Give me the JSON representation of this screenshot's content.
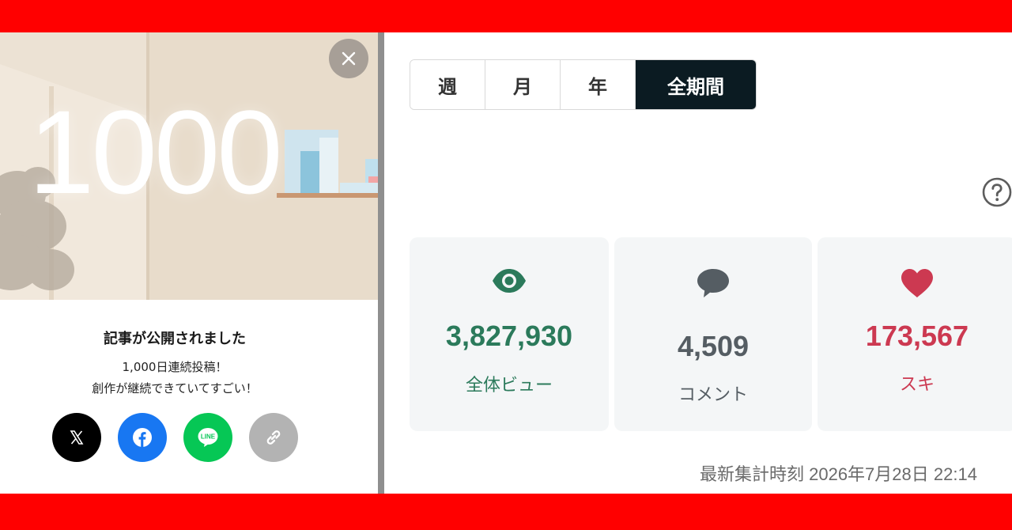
{
  "modal": {
    "hero_number": "1000",
    "title": "記事が公開されました",
    "line1": "1,000日連続投稿！",
    "line2": "創作が継続できていてすごい！"
  },
  "tabs": [
    {
      "label": "週",
      "active": false
    },
    {
      "label": "月",
      "active": false
    },
    {
      "label": "年",
      "active": false
    },
    {
      "label": "全期間",
      "active": true
    }
  ],
  "stats": {
    "views": {
      "value": "3,827,930",
      "label": "全体ビュー",
      "color": "#2b7a5b",
      "icon": "eye-icon"
    },
    "comments": {
      "value": "4,509",
      "label": "コメント",
      "color": "#555d63",
      "icon": "comment-icon"
    },
    "likes": {
      "value": "173,567",
      "label": "スキ",
      "color": "#cc3951",
      "icon": "heart-icon"
    }
  },
  "updated": "最新集計時刻 2026年7月28日 22:14",
  "share_icons": [
    "x-icon",
    "facebook-icon",
    "line-icon",
    "link-icon"
  ],
  "colors": {
    "accent_red": "#ff0000",
    "active_tab": "#0b1b22"
  }
}
